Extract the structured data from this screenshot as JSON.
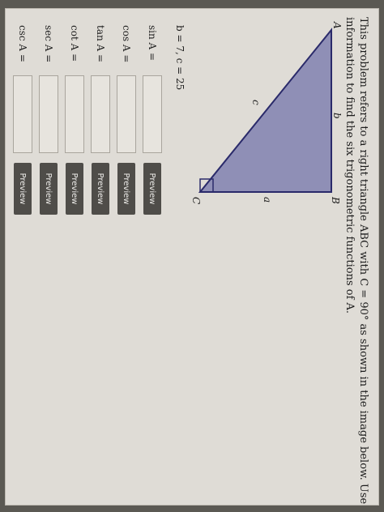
{
  "problem": {
    "line1": "This problem refers to a right triangle ABC with C = 90° as shown in the image below. Use the given",
    "line2": "information to find the six trigonometric functions of A."
  },
  "triangle": {
    "vertex_a": "A",
    "vertex_b": "B",
    "vertex_c": "C",
    "side_a": "a",
    "side_b": "b",
    "side_c": "c",
    "fill_color": "#8f8fb6"
  },
  "given": "b = 7, c = 25",
  "functions": [
    {
      "label": "sin A =",
      "value": "",
      "button": "Preview"
    },
    {
      "label": "cos A =",
      "value": "",
      "button": "Preview"
    },
    {
      "label": "tan A =",
      "value": "",
      "button": "Preview"
    },
    {
      "label": "cot A =",
      "value": "",
      "button": "Preview"
    },
    {
      "label": "sec A =",
      "value": "",
      "button": "Preview"
    },
    {
      "label": "csc A =",
      "value": "",
      "button": "Preview"
    }
  ]
}
